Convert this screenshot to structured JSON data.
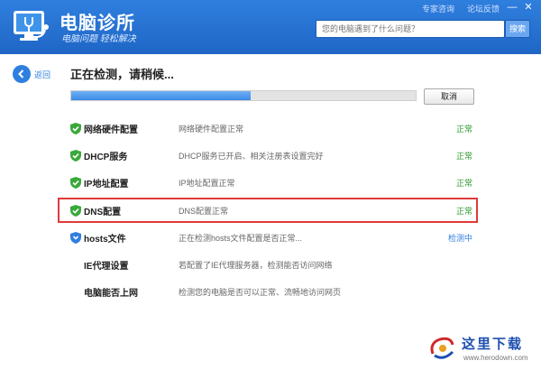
{
  "app": {
    "title": "电脑诊所",
    "subtitle": "电脑问题 轻松解决",
    "links": [
      "专家咨询",
      "论坛反馈"
    ],
    "min": "—",
    "close": "✕"
  },
  "search": {
    "placeholder": "您的电脑遇到了什么问题？",
    "button": "搜索"
  },
  "back_label": "返回",
  "status_title": "正在检测，请稍候...",
  "progress": 0.52,
  "cancel_label": "取消",
  "checks": [
    {
      "name": "网络硬件配置",
      "desc": "网络硬件配置正常",
      "status": "正常"
    },
    {
      "name": "DHCP服务",
      "desc": "DHCP服务已开启、相关注册表设置完好",
      "status": "正常"
    },
    {
      "name": "IP地址配置",
      "desc": "IP地址配置正常",
      "status": "正常"
    },
    {
      "name": "DNS配置",
      "desc": "DNS配置正常",
      "status": "正常"
    },
    {
      "name": "hosts文件",
      "desc": "正在检测hosts文件配置是否正常...",
      "status": "检测中"
    },
    {
      "name": "IE代理设置",
      "desc": "若配置了IE代理服务器，检测能否访问网络",
      "status": ""
    },
    {
      "name": "电脑能否上网",
      "desc": "检测您的电脑是否可以正常、流畅地访问网页",
      "status": ""
    }
  ],
  "watermark": {
    "text": "这里下载",
    "url": "www.herodown.com"
  },
  "colors": {
    "brand": "#2f7fde",
    "ok": "#2e9a2e",
    "highlight": "#e03a3a"
  }
}
